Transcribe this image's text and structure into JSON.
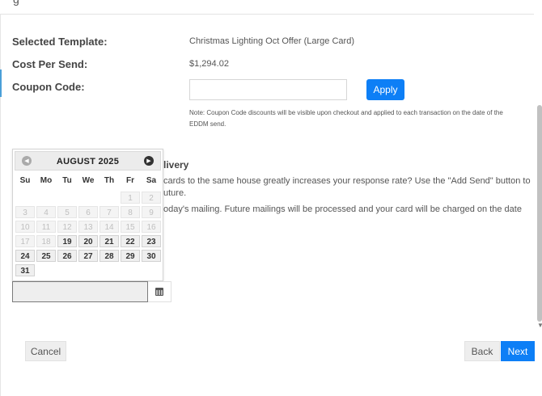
{
  "header": {
    "title": "g"
  },
  "summary": {
    "template_label": "Selected Template:",
    "template_value": "Christmas Lighting Oct Offer (Large Card)",
    "cost_label": "Cost Per Send:",
    "cost_value": "$1,294.02",
    "coupon_label": "Coupon Code:",
    "coupon_value": "",
    "coupon_placeholder": "",
    "apply_label": "Apply",
    "coupon_note": "Note: Coupon Code discounts will be visible upon checkout and applied to each transaction on the date of the EDDM send."
  },
  "delivery": {
    "title": "livery",
    "line1": "cards to the same house greatly increases your response rate? Use the \"Add Send\" button to",
    "line2": "uture.",
    "line3": "oday's mailing. Future mailings will be processed and your card will be charged on the date",
    "date_value": "",
    "calendar_icon": "calendar-icon"
  },
  "datepicker": {
    "title": "AUGUST 2025",
    "prev_icon": "chevron-left-icon",
    "next_icon": "chevron-right-icon",
    "prev_glyph": "◀",
    "next_glyph": "▶",
    "days_of_week": [
      "Su",
      "Mo",
      "Tu",
      "We",
      "Th",
      "Fr",
      "Sa"
    ],
    "weeks": [
      [
        {
          "d": ""
        },
        {
          "d": ""
        },
        {
          "d": ""
        },
        {
          "d": ""
        },
        {
          "d": ""
        },
        {
          "d": "1",
          "s": "disabled"
        },
        {
          "d": "2",
          "s": "disabled"
        }
      ],
      [
        {
          "d": "3",
          "s": "disabled"
        },
        {
          "d": "4",
          "s": "disabled"
        },
        {
          "d": "5",
          "s": "disabled"
        },
        {
          "d": "6",
          "s": "disabled"
        },
        {
          "d": "7",
          "s": "disabled"
        },
        {
          "d": "8",
          "s": "disabled"
        },
        {
          "d": "9",
          "s": "disabled"
        }
      ],
      [
        {
          "d": "10",
          "s": "disabled"
        },
        {
          "d": "11",
          "s": "disabled"
        },
        {
          "d": "12",
          "s": "disabled"
        },
        {
          "d": "13",
          "s": "disabled"
        },
        {
          "d": "14",
          "s": "disabled"
        },
        {
          "d": "15",
          "s": "disabled"
        },
        {
          "d": "16",
          "s": "disabled"
        }
      ],
      [
        {
          "d": "17",
          "s": "disabled"
        },
        {
          "d": "18",
          "s": "disabled"
        },
        {
          "d": "19",
          "s": "enabled"
        },
        {
          "d": "20",
          "s": "enabled"
        },
        {
          "d": "21",
          "s": "enabled"
        },
        {
          "d": "22",
          "s": "enabled"
        },
        {
          "d": "23",
          "s": "enabled"
        }
      ],
      [
        {
          "d": "24",
          "s": "enabled"
        },
        {
          "d": "25",
          "s": "enabled"
        },
        {
          "d": "26",
          "s": "enabled"
        },
        {
          "d": "27",
          "s": "enabled"
        },
        {
          "d": "28",
          "s": "enabled"
        },
        {
          "d": "29",
          "s": "enabled"
        },
        {
          "d": "30",
          "s": "enabled"
        }
      ],
      [
        {
          "d": "31",
          "s": "enabled"
        },
        {
          "d": ""
        },
        {
          "d": ""
        },
        {
          "d": ""
        },
        {
          "d": ""
        },
        {
          "d": ""
        },
        {
          "d": ""
        }
      ]
    ]
  },
  "footer": {
    "cancel_label": "Cancel",
    "back_label": "Back",
    "next_label": "Next"
  },
  "colors": {
    "primary": "#0d7ff6",
    "accent": "#4a9fd8",
    "disabled_day": "#bfbfbf"
  }
}
